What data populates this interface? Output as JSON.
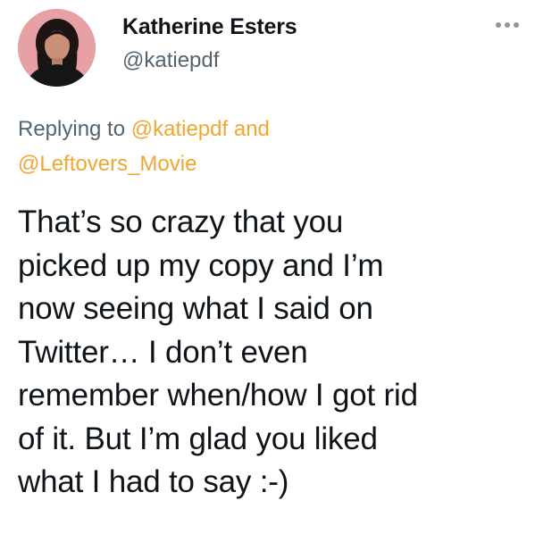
{
  "author": {
    "display_name": "Katherine Esters",
    "handle": "@katiepdf",
    "avatar_icon": "profile-photo"
  },
  "more_icon": "ellipsis-horizontal-icon",
  "reply": {
    "prefix": "Replying to ",
    "mention_1": "@katiepdf",
    "connector": " and",
    "mention_2": "@Leftovers_Movie"
  },
  "tweet": {
    "text": "That’s so crazy that you\npicked up my copy and I’m\nnow seeing what I said on\nTwitter… I don’t even\nremember when/how I got rid\nof it. But I’m glad you liked\nwhat I had to say :-)"
  },
  "colors": {
    "mention": "#f0a732",
    "secondary_text": "#536471",
    "primary_text": "#0f1419",
    "avatar_background": "#e7a0a4"
  }
}
